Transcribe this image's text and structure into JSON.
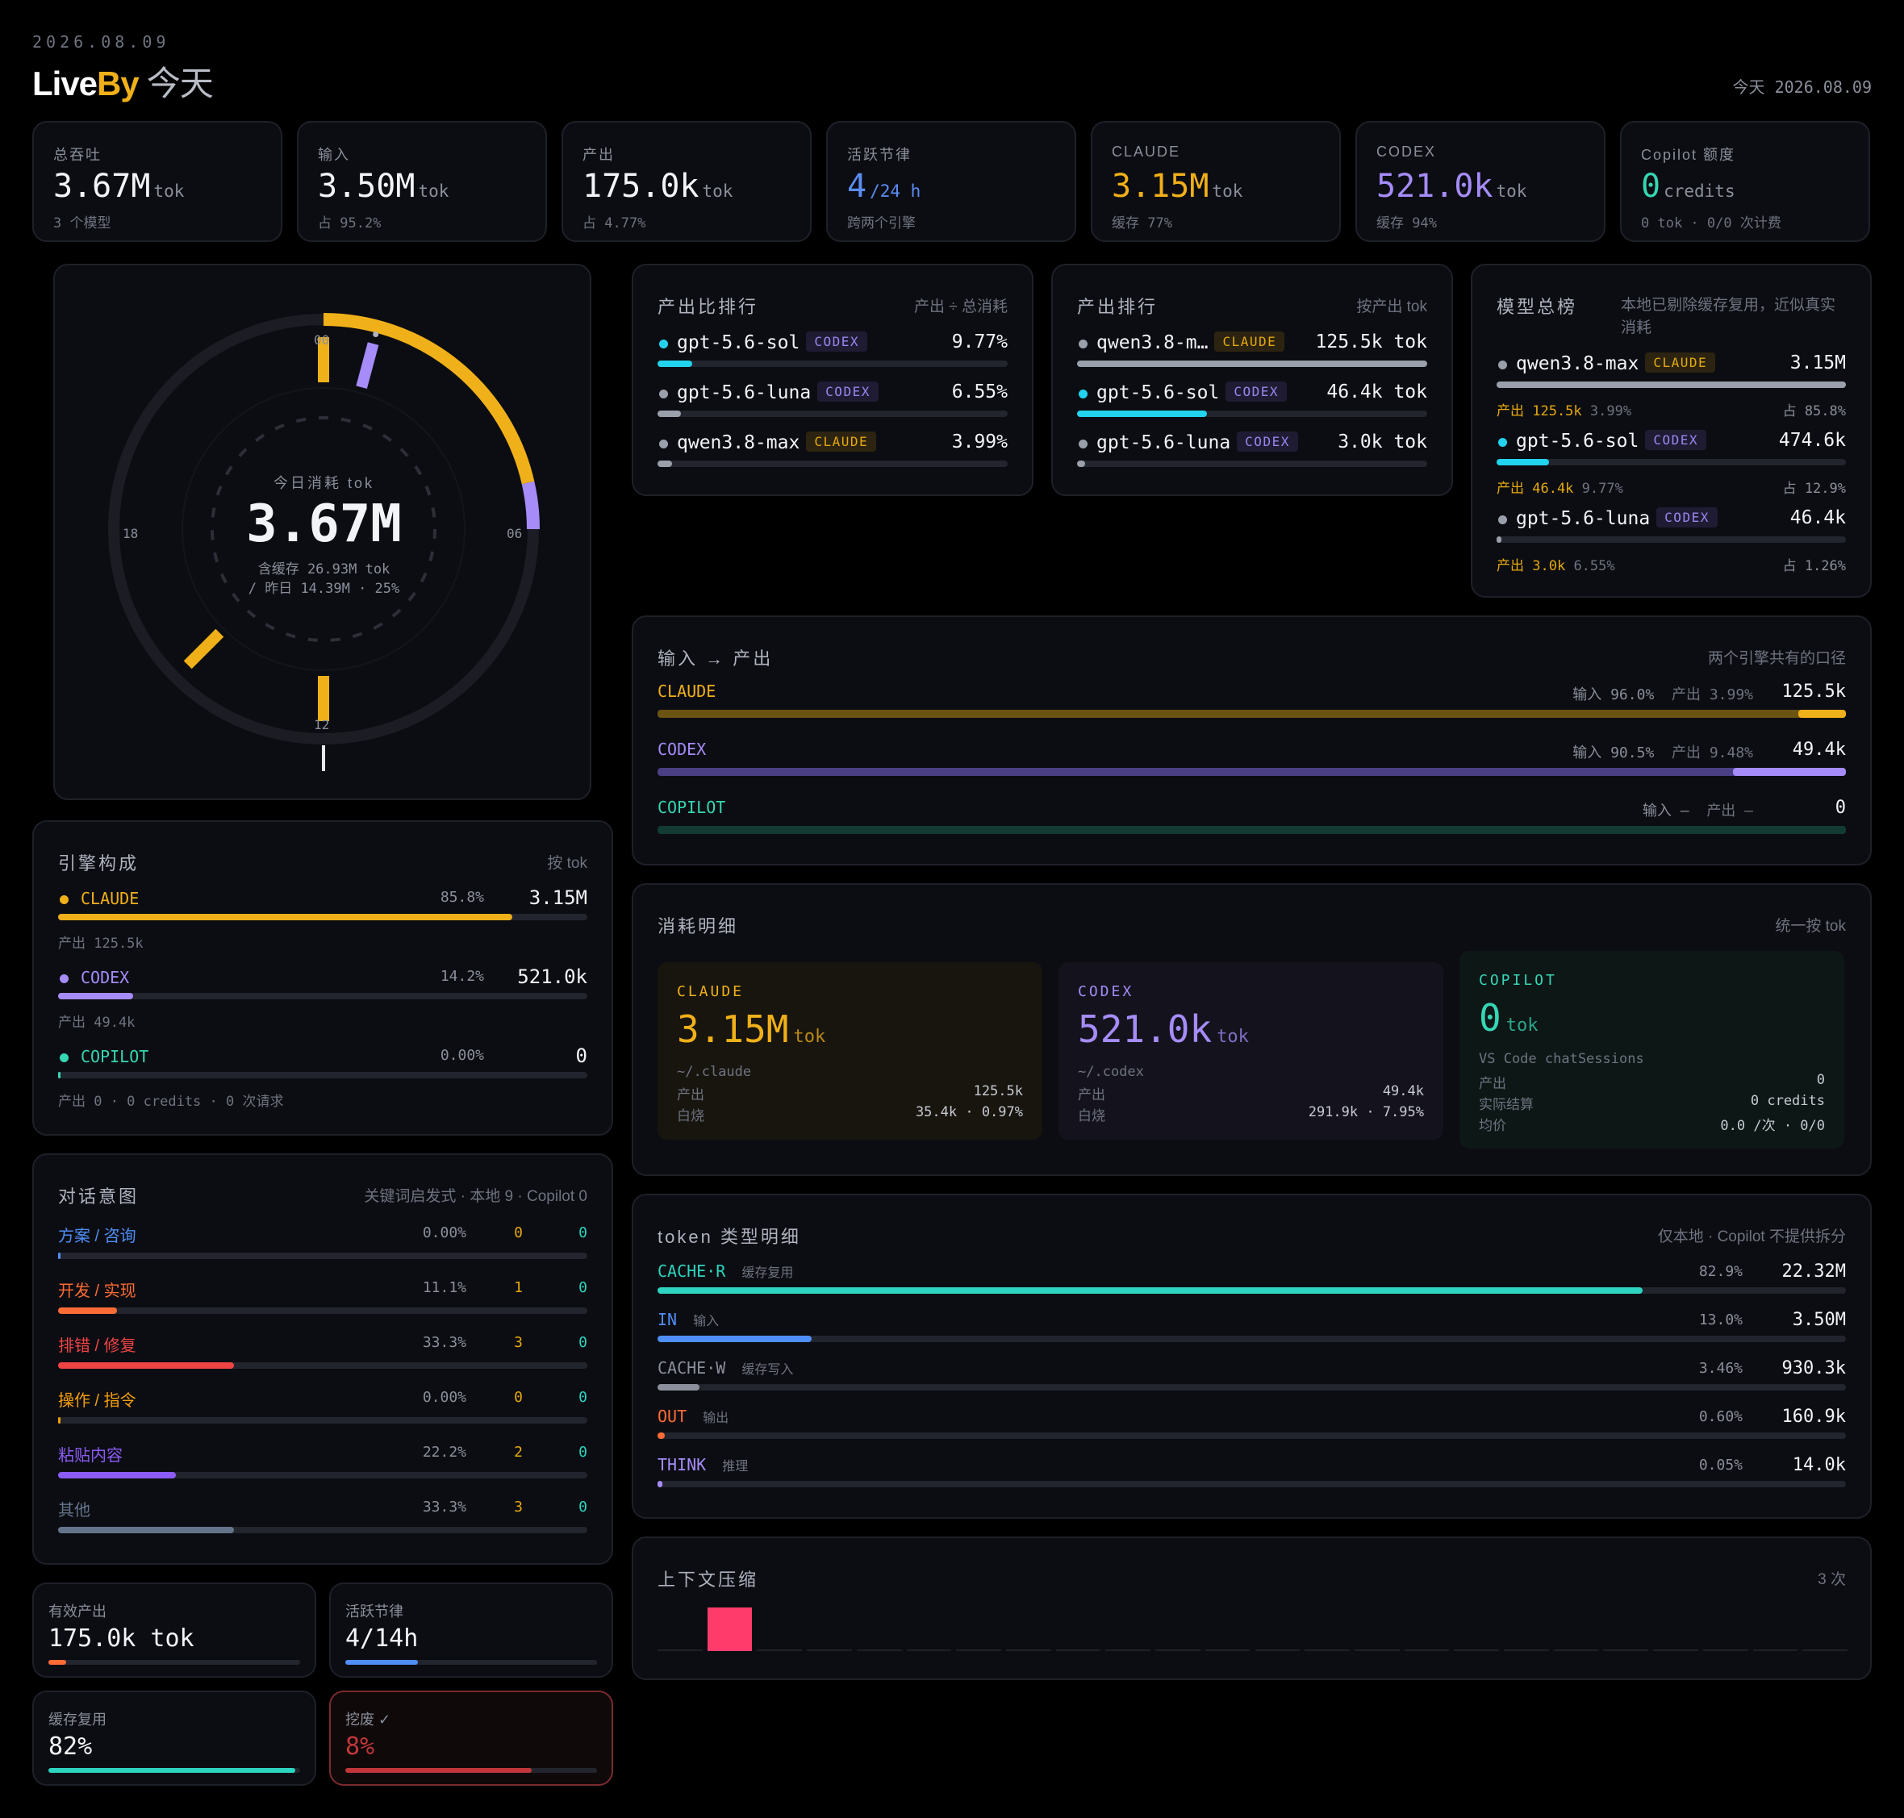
{
  "header": {
    "date": "2026.08.09",
    "brand_live": "Live",
    "brand_by": "By",
    "brand_today": "今天",
    "right": "今天 2026.08.09"
  },
  "kpis": [
    {
      "label": "总吞吐",
      "value": "3.67M",
      "unit": "tok",
      "sub": "3 个模型",
      "color": "#f3f4f7"
    },
    {
      "label": "输入",
      "value": "3.50M",
      "unit": "tok",
      "sub": "占 95.2%",
      "color": "#f3f4f7"
    },
    {
      "label": "产出",
      "value": "175.0k",
      "unit": "tok",
      "sub": "占 4.77%",
      "color": "#f3f4f7"
    },
    {
      "label": "活跃节律",
      "value": "4",
      "unit": "/24 h",
      "sub": "跨两个引擎",
      "color": "#5b8df5"
    },
    {
      "label": "CLAUDE",
      "value": "3.15M",
      "unit": "tok",
      "sub": "缓存 77%",
      "color": "#f0b019"
    },
    {
      "label": "CODEX",
      "value": "521.0k",
      "unit": "tok",
      "sub": "缓存 94%",
      "color": "#a58cf8"
    },
    {
      "label": "Copilot 额度",
      "value": "0",
      "unit": "credits",
      "sub": "0 tok · 0/0 次计费",
      "color": "#36d6b3"
    }
  ],
  "clock": {
    "label": "今日消耗 tok",
    "total": "3.67M",
    "cache": "含缓存 26.93M tok",
    "compare": "/ 昨日 14.39M · 25%",
    "h00": "00",
    "h06": "06",
    "h12": "12",
    "h18": "18",
    "claude_fraction": 0.858,
    "codex_fraction": 0.142,
    "active_hours": [
      0,
      1,
      15,
      12
    ]
  },
  "engine_mix": {
    "title": "引擎构成",
    "note": "按 tok",
    "items": [
      {
        "name": "CLAUDE",
        "pct": "85.8%",
        "value": "3.15M",
        "sub": "产出 125.5k",
        "frac": 0.858,
        "color": "#f0b019"
      },
      {
        "name": "CODEX",
        "pct": "14.2%",
        "value": "521.0k",
        "sub": "产出 49.4k",
        "frac": 0.142,
        "color": "#a58cf8"
      },
      {
        "name": "COPILOT",
        "pct": "0.00%",
        "value": "0",
        "sub": "产出 0 · 0 credits · 0 次请求",
        "frac": 0.004,
        "color": "#36d6b3"
      }
    ]
  },
  "intent": {
    "title": "对话意图",
    "note": "关键词启发式 · 本地 9 · Copilot 0",
    "items": [
      {
        "name": "方案 / 咨询",
        "pct": "0.00%",
        "a": "0",
        "b": "0",
        "frac": 0.004,
        "color": "#4f8ef7"
      },
      {
        "name": "开发 / 实现",
        "pct": "11.1%",
        "a": "1",
        "b": "0",
        "frac": 0.111,
        "color": "#ff6b35"
      },
      {
        "name": "排错 / 修复",
        "pct": "33.3%",
        "a": "3",
        "b": "0",
        "frac": 0.333,
        "color": "#ef4444"
      },
      {
        "name": "操作 / 指令",
        "pct": "0.00%",
        "a": "0",
        "b": "0",
        "frac": 0.004,
        "color": "#f59e0b"
      },
      {
        "name": "粘贴内容",
        "pct": "22.2%",
        "a": "2",
        "b": "0",
        "frac": 0.222,
        "color": "#8b5cf6"
      },
      {
        "name": "其他",
        "pct": "33.3%",
        "a": "3",
        "b": "0",
        "frac": 0.333,
        "color": "#64748b"
      }
    ]
  },
  "mini": [
    {
      "label": "有效产出",
      "value": "175.0k tok",
      "frac": 0.07,
      "color": "#ff6b35"
    },
    {
      "label": "活跃节律",
      "value": "4/14h",
      "frac": 0.29,
      "color": "#4f8ef7"
    },
    {
      "label": "缓存复用",
      "value": "82%",
      "frac": 0.98,
      "color": "#2dd4bf"
    },
    {
      "label": "挖废 ✓",
      "value": "8%",
      "frac": 0.74,
      "color": "#c0363a"
    }
  ],
  "ratio_rank": {
    "title": "产出比排行",
    "note": "产出 ÷ 总消耗",
    "items": [
      {
        "name": "gpt-5.6-sol",
        "tag": "CODEX",
        "value": "9.77%",
        "frac": 0.1,
        "dot": "#22d3ee",
        "bar": "#22d3ee"
      },
      {
        "name": "gpt-5.6-luna",
        "tag": "CODEX",
        "value": "6.55%",
        "frac": 0.067,
        "dot": "#9aa0ab",
        "bar": "#9aa0ab"
      },
      {
        "name": "qwen3.8-max",
        "tag": "CLAUDE",
        "value": "3.99%",
        "frac": 0.041,
        "dot": "#9aa0ab",
        "bar": "#9aa0ab"
      }
    ]
  },
  "output_rank": {
    "title": "产出排行",
    "note": "按产出 tok",
    "items": [
      {
        "name": "qwen3.8-m…",
        "tag": "CLAUDE",
        "value": "125.5k tok",
        "frac": 1.0,
        "dot": "#9aa0ab",
        "bar": "#9aa0ab"
      },
      {
        "name": "gpt-5.6-sol",
        "tag": "CODEX",
        "value": "46.4k tok",
        "frac": 0.37,
        "dot": "#22d3ee",
        "bar": "#22d3ee"
      },
      {
        "name": "gpt-5.6-luna",
        "tag": "CODEX",
        "value": "3.0k tok",
        "frac": 0.024,
        "dot": "#9aa0ab",
        "bar": "#9aa0ab"
      }
    ]
  },
  "model_board": {
    "title": "模型总榜",
    "note": "本地已剔除缓存复用，近似真实消耗",
    "items": [
      {
        "name": "qwen3.8-max",
        "tag": "CLAUDE",
        "value": "3.15M",
        "out": "产出 125.5k",
        "ratio": "3.99%",
        "share": "占 85.8%",
        "frac": 1.0,
        "dot": "#9aa0ab",
        "bar": "#9aa0ab"
      },
      {
        "name": "gpt-5.6-sol",
        "tag": "CODEX",
        "value": "474.6k",
        "out": "产出 46.4k",
        "ratio": "9.77%",
        "share": "占 12.9%",
        "frac": 0.151,
        "dot": "#22d3ee",
        "bar": "#22d3ee"
      },
      {
        "name": "gpt-5.6-luna",
        "tag": "CODEX",
        "value": "46.4k",
        "out": "产出 3.0k",
        "ratio": "6.55%",
        "share": "占 1.26%",
        "frac": 0.015,
        "dot": "#9aa0ab",
        "bar": "#9aa0ab"
      }
    ]
  },
  "io": {
    "title": "输入 → 产出",
    "note": "两个引擎共有的口径",
    "items": [
      {
        "name": "CLAUDE",
        "in_label": "输入",
        "in_pct": "96.0%",
        "out_label": "产出",
        "out_pct": "3.99%",
        "value": "125.5k",
        "out_frac": 0.04,
        "color": "#f0b019",
        "base": "#6b5314"
      },
      {
        "name": "CODEX",
        "in_label": "输入",
        "in_pct": "90.5%",
        "out_label": "产出",
        "out_pct": "9.48%",
        "value": "49.4k",
        "out_frac": 0.095,
        "color": "#a58cf8",
        "base": "#4a3f85"
      },
      {
        "name": "COPILOT",
        "in_label": "输入",
        "in_pct": "—",
        "out_label": "产出",
        "out_pct": "—",
        "value": "0",
        "out_frac": 0,
        "color": "#36d6b3",
        "base": "#123b34"
      }
    ]
  },
  "detail": {
    "title": "消耗明细",
    "note": "统一按 tok",
    "cards": [
      {
        "name": "CLAUDE",
        "value": "3.15M",
        "unit": "tok",
        "path": "~/.claude",
        "r1k": "产出",
        "r1v": "125.5k",
        "r2k": "白烧",
        "r2v": "35.4k · 0.97%",
        "color": "#f0b019",
        "bg": "#17150e"
      },
      {
        "name": "CODEX",
        "value": "521.0k",
        "unit": "tok",
        "path": "~/.codex",
        "r1k": "产出",
        "r1v": "49.4k",
        "r2k": "白烧",
        "r2v": "291.9k · 7.95%",
        "color": "#a58cf8",
        "bg": "#14131d"
      },
      {
        "name": "COPILOT",
        "value": "0",
        "unit": "tok",
        "path": "VS Code chatSessions",
        "r1k": "产出",
        "r1v": "0",
        "r2k": "实际结算",
        "r2v": "0 credits",
        "r3k": "均价",
        "r3v": "0.0 /次 · 0/0",
        "color": "#36d6b3",
        "bg": "#0d1716"
      }
    ]
  },
  "token_types": {
    "title": "token 类型明细",
    "note": "仅本地 · Copilot 不提供拆分",
    "items": [
      {
        "name": "CACHE·R",
        "desc": "缓存复用",
        "pct": "82.9%",
        "value": "22.32M",
        "frac": 0.829,
        "color": "#2dd4bf"
      },
      {
        "name": "IN",
        "desc": "输入",
        "pct": "13.0%",
        "value": "3.50M",
        "frac": 0.13,
        "color": "#4f8ef7"
      },
      {
        "name": "CACHE·W",
        "desc": "缓存写入",
        "pct": "3.46%",
        "value": "930.3k",
        "frac": 0.035,
        "color": "#8a8f9b"
      },
      {
        "name": "OUT",
        "desc": "输出",
        "pct": "0.60%",
        "value": "160.9k",
        "frac": 0.006,
        "color": "#ff6b35"
      },
      {
        "name": "THINK",
        "desc": "推理",
        "pct": "0.05%",
        "value": "14.0k",
        "frac": 0.002,
        "color": "#a58cf8"
      }
    ]
  },
  "compress": {
    "title": "上下文压缩",
    "note": "3 次",
    "counts": [
      0,
      3,
      0,
      0,
      0,
      0,
      0,
      0,
      0,
      0,
      0,
      0,
      0,
      0,
      0,
      0,
      0,
      0,
      0,
      0,
      0,
      0,
      0,
      0
    ]
  }
}
